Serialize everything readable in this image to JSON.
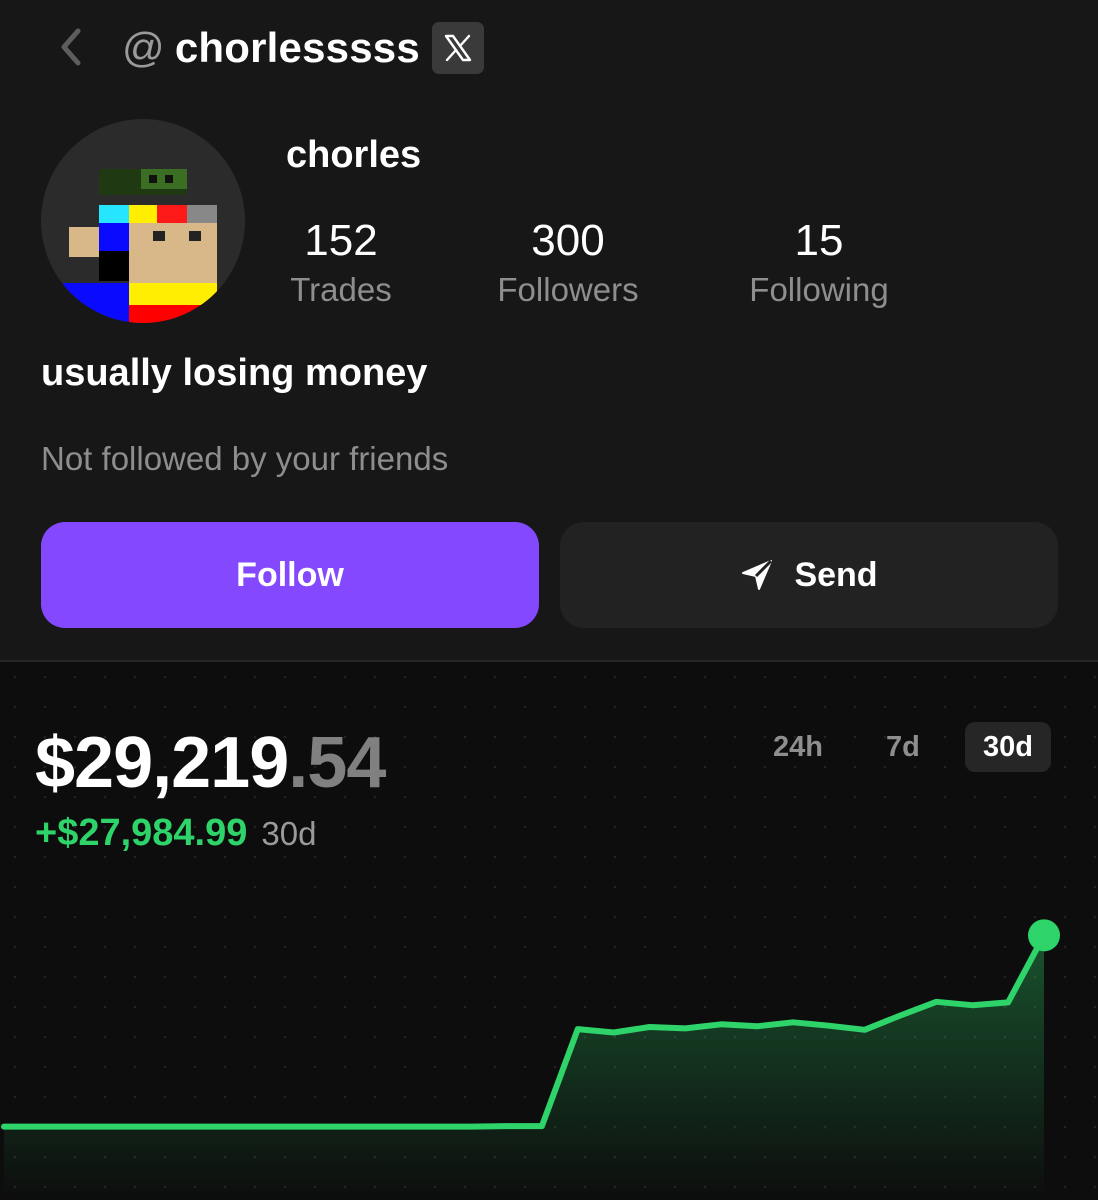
{
  "header": {
    "handle_prefix": "@",
    "handle": "chorlesssss",
    "x_badge_icon": "x-logo-icon"
  },
  "profile": {
    "display_name": "chorles",
    "bio": "usually losing money",
    "friends_note": "Not followed by your friends",
    "stats": [
      {
        "value": "152",
        "label": "Trades"
      },
      {
        "value": "300",
        "label": "Followers"
      },
      {
        "value": "15",
        "label": "Following"
      }
    ]
  },
  "actions": {
    "follow_label": "Follow",
    "send_label": "Send"
  },
  "portfolio": {
    "balance_main": "$29,219",
    "balance_cents": ".54",
    "gain": "+$27,984.99",
    "gain_period": "30d",
    "ranges": [
      "24h",
      "7d",
      "30d"
    ],
    "selected_range": "30d"
  },
  "colors": {
    "accent": "#8448ff",
    "positive": "#2ed46a",
    "background": "#151515"
  },
  "chart_data": {
    "type": "area",
    "title": "",
    "xlabel": "",
    "ylabel": "",
    "x": [
      1,
      2,
      3,
      4,
      5,
      6,
      7,
      8,
      9,
      10,
      11,
      12,
      13,
      14,
      15,
      16,
      17,
      18,
      19,
      20,
      21,
      22,
      23,
      24,
      25,
      26,
      27,
      28,
      29,
      30
    ],
    "values": [
      1235,
      1235,
      1235,
      1235,
      1235,
      1235,
      1235,
      1235,
      1235,
      1235,
      1235,
      1235,
      1235,
      1235,
      1300,
      1300,
      15500,
      15000,
      15800,
      15600,
      16200,
      15900,
      16500,
      16000,
      15400,
      17500,
      19500,
      19000,
      19400,
      29219
    ],
    "ylim": [
      0,
      30000
    ]
  }
}
